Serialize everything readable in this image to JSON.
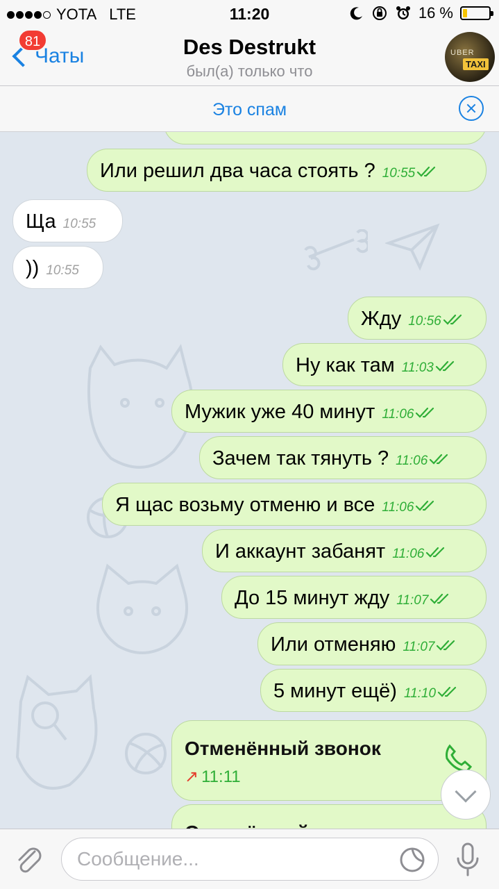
{
  "status_bar": {
    "carrier": "YOTA",
    "network": "LTE",
    "time": "11:20",
    "battery": "16 %",
    "battery_level": 0.16
  },
  "header": {
    "back_label": "Чаты",
    "unread_badge": "81",
    "contact_name": "Des Destrukt",
    "contact_status": "был(а) только что",
    "avatar_text_top": "UBER",
    "avatar_text_bottom": "TAXI"
  },
  "spam_bar": {
    "label": "Это спам"
  },
  "messages": [
    {
      "dir": "out",
      "text": "Или решил два часа стоять ?",
      "time": "10:55"
    },
    {
      "dir": "in",
      "text": "Ща",
      "time": "10:55"
    },
    {
      "dir": "in",
      "text": "))",
      "time": "10:55"
    },
    {
      "dir": "out",
      "text": "Жду",
      "time": "10:56"
    },
    {
      "dir": "out",
      "text": "Ну как там",
      "time": "11:03"
    },
    {
      "dir": "out",
      "text": "Мужик уже 40 минут",
      "time": "11:06"
    },
    {
      "dir": "out",
      "text": "Зачем так тянуть ?",
      "time": "11:06"
    },
    {
      "dir": "out",
      "text": "Я щас возьму отменю и все",
      "time": "11:06"
    },
    {
      "dir": "out",
      "text": "И аккаунт забанят",
      "time": "11:06"
    },
    {
      "dir": "out",
      "text": "До 15 минут жду",
      "time": "11:07"
    },
    {
      "dir": "out",
      "text": "Или отменяю",
      "time": "11:07"
    },
    {
      "dir": "out",
      "text": "5 минут ещё)",
      "time": "11:10"
    }
  ],
  "calls": [
    {
      "title": "Отменённый звонок",
      "time": "11:11"
    },
    {
      "title": "Отменённый звонок"
    }
  ],
  "input": {
    "placeholder": "Сообщение..."
  },
  "colors": {
    "accent": "#1a82e2",
    "outgoing_bubble": "#e2f9c8",
    "incoming_bubble": "#ffffff",
    "read_check": "#2fae37",
    "badge": "#f23c34",
    "missed_arrow": "#e4402f",
    "chat_background": "#dfe6ee"
  },
  "icons": [
    "back-chevron-icon",
    "close-circle-icon",
    "double-check-icon",
    "phone-icon",
    "missed-call-arrow-icon",
    "scroll-down-icon",
    "paperclip-icon",
    "sticker-icon",
    "microphone-icon",
    "moon-icon",
    "orientation-lock-icon",
    "alarm-icon",
    "battery-icon"
  ]
}
